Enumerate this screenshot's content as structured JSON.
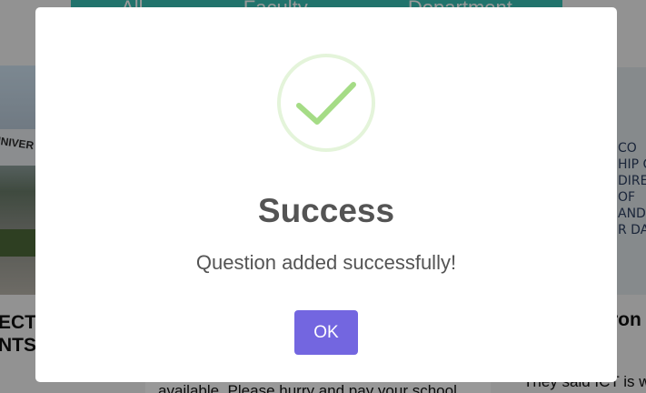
{
  "background": {
    "tabs": [
      "All",
      "Faculty",
      "Department"
    ],
    "left_card": {
      "image_sign": "UNIVER",
      "title_lines": [
        "ECTS",
        "NTS"
      ]
    },
    "right_card": {
      "image_writing": "CO\nHIP CO\nDIRE\nOF\nAND\nR DAN",
      "title": "ron",
      "snippet": "They said ICT is w"
    },
    "center_card": {
      "snippet": "available. Please hurry and pay your school"
    }
  },
  "modal": {
    "icon": "checkmark-icon",
    "title": "Success",
    "message": "Question added successfully!",
    "ok_label": "OK",
    "colors": {
      "check": "#a5dc86",
      "ring": "rgba(165,220,134,0.3)",
      "button": "#7366e0"
    }
  }
}
